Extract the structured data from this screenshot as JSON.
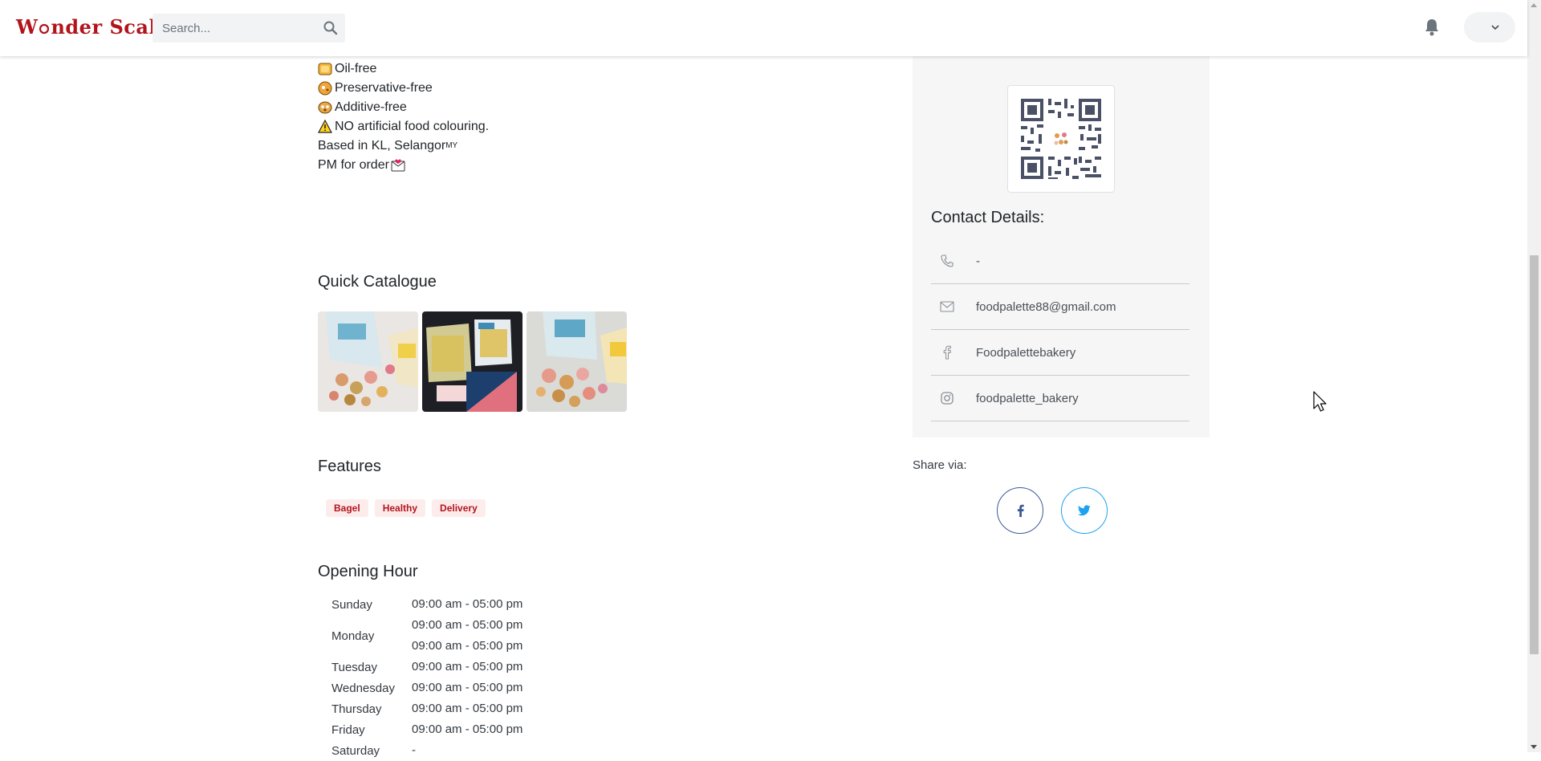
{
  "header": {
    "logo": "W nder Scale",
    "search_placeholder": "Search...",
    "icons": [
      "search-icon",
      "bell-icon",
      "chevron-down-icon"
    ]
  },
  "description": {
    "lines": [
      {
        "icon": "oil-free-emoji",
        "text": "Oil-free"
      },
      {
        "icon": "preservative-free-emoji",
        "text": "Preservative-free"
      },
      {
        "icon": "additive-free-emoji",
        "text": "Additive-free"
      },
      {
        "icon": "warning-emoji",
        "text": "NO artificial food colouring."
      },
      {
        "icon": "",
        "text": "Based in KL, Selangor",
        "suffix": "MY"
      },
      {
        "icon": "",
        "text": "PM for order",
        "suffix_icon": "envelope-emoji"
      }
    ]
  },
  "catalogue": {
    "title": "Quick Catalogue",
    "images": [
      "catalogue-photo-1",
      "catalogue-photo-2",
      "catalogue-photo-3"
    ]
  },
  "features": {
    "title": "Features",
    "tags": [
      "Bagel",
      "Healthy",
      "Delivery"
    ]
  },
  "opening": {
    "title": "Opening Hour",
    "rows": [
      {
        "day": "Sunday",
        "times": [
          "09:00 am - 05:00 pm"
        ]
      },
      {
        "day": "Monday",
        "times": [
          "09:00 am - 05:00 pm",
          "09:00 am - 05:00 pm"
        ]
      },
      {
        "day": "Tuesday",
        "times": [
          "09:00 am - 05:00 pm"
        ]
      },
      {
        "day": "Wednesday",
        "times": [
          "09:00 am - 05:00 pm"
        ]
      },
      {
        "day": "Thursday",
        "times": [
          "09:00 am - 05:00 pm"
        ]
      },
      {
        "day": "Friday",
        "times": [
          "09:00 am - 05:00 pm"
        ]
      },
      {
        "day": "Saturday",
        "times": [
          "-"
        ]
      }
    ]
  },
  "contact": {
    "title": "Contact Details:",
    "items": [
      {
        "icon": "phone-icon",
        "text": "-"
      },
      {
        "icon": "envelope-icon",
        "text": "foodpalette88@gmail.com"
      },
      {
        "icon": "facebook-icon",
        "text": "Foodpalettebakery"
      },
      {
        "icon": "instagram-icon",
        "text": "foodpalette_bakery"
      }
    ]
  },
  "share": {
    "label": "Share via:",
    "buttons": [
      "facebook-icon",
      "twitter-icon"
    ]
  },
  "colors": {
    "brand": "#b3141c",
    "tag_bg": "#fdecec",
    "panel_bg": "#f6f6f6",
    "facebook": "#3b5998",
    "twitter": "#1da1f2"
  }
}
